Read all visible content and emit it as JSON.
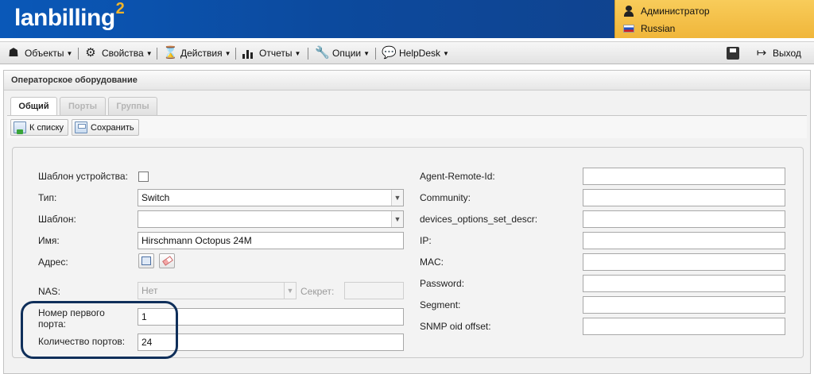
{
  "header": {
    "logo_text": "lanbilling",
    "logo_super": "2",
    "user": "Администратор",
    "language": "Russian"
  },
  "menubar": {
    "items": [
      {
        "label": "Объекты",
        "icon": "objects-icon"
      },
      {
        "label": "Свойства",
        "icon": "gear-icon"
      },
      {
        "label": "Действия",
        "icon": "hourglass-icon"
      },
      {
        "label": "Отчеты",
        "icon": "bar-chart-icon"
      },
      {
        "label": "Опции",
        "icon": "wrench-icon"
      },
      {
        "label": "HelpDesk",
        "icon": "speech-bubble-icon"
      }
    ],
    "exit_label": "Выход"
  },
  "panel": {
    "title": "Операторское оборудование",
    "tabs": [
      {
        "label": "Общий",
        "active": true
      },
      {
        "label": "Порты",
        "active": false
      },
      {
        "label": "Группы",
        "active": false
      }
    ],
    "toolbar": {
      "back_label": "К списку",
      "save_label": "Сохранить"
    }
  },
  "form": {
    "left": {
      "template_device_label": "Шаблон устройства:",
      "template_device_checked": false,
      "type_label": "Тип:",
      "type_value": "Switch",
      "template_label": "Шаблон:",
      "template_value": "",
      "name_label": "Имя:",
      "name_value": "Hirschmann Octopus 24M",
      "address_label": "Адрес:",
      "nas_label": "NAS:",
      "nas_value": "Нет",
      "secret_label": "Секрет:",
      "secret_value": "",
      "first_port_label_line1": "Номер первого",
      "first_port_label_line2": "порта:",
      "first_port_value": "1",
      "port_count_label": "Количество портов:",
      "port_count_value": "24"
    },
    "right": {
      "fields": [
        {
          "label": "Agent-Remote-Id:",
          "value": ""
        },
        {
          "label": "Community:",
          "value": ""
        },
        {
          "label": "devices_options_set_descr:",
          "value": ""
        },
        {
          "label": "IP:",
          "value": ""
        },
        {
          "label": "MAC:",
          "value": ""
        },
        {
          "label": "Password:",
          "value": ""
        },
        {
          "label": "Segment:",
          "value": ""
        },
        {
          "label": "SNMP oid offset:",
          "value": ""
        }
      ]
    }
  },
  "colors": {
    "header_blue": "#0c4a9e",
    "user_panel_yellow": "#f4c04a",
    "logo_accent": "#f0b42a",
    "highlight_ring": "#0f2f5a"
  }
}
